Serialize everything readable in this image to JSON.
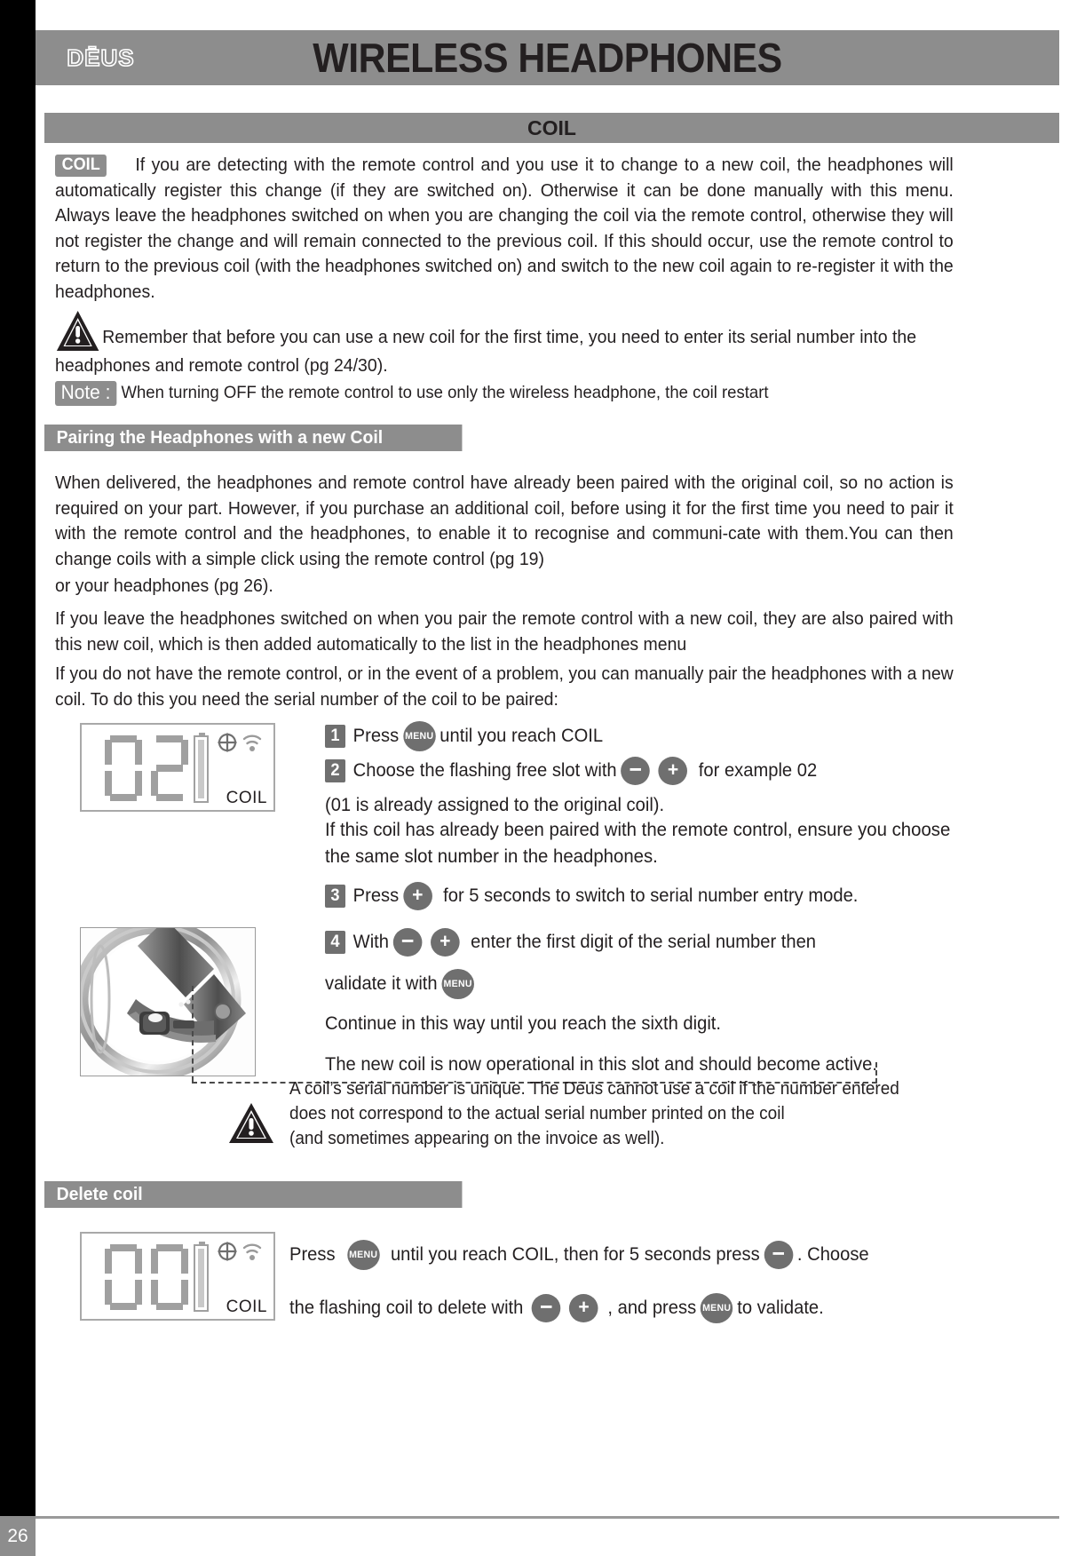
{
  "header": {
    "brand": "DĒUS",
    "title": "WIRELESS HEADPHONES",
    "section": "COIL"
  },
  "intro": {
    "chip": "COIL",
    "text": "If you are detecting with the remote control and you use it to change to a new coil, the headphones will automatically register this change (if they are switched on). Otherwise it can be done manually with this menu. Always leave the headphones switched on when you are changing the coil via the remote control, otherwise they will not register the change and will remain connected to the previous coil. If this should occur, use the remote control to return to the previous coil (with the headphones switched on) and switch to the new coil again to re-register it with the headphones."
  },
  "warning_1": {
    "icon": "warning-triangle-icon",
    "text": "Remember that before you can use a new coil for the first time, you need to enter its serial number into the headphones and remote control (pg 24/30)."
  },
  "note": {
    "label": "Note :",
    "text": "When turning OFF the remote control to use only the wireless headphone, the coil restart"
  },
  "pairing": {
    "heading": "Pairing the Headphones with a new Coil",
    "para_1": "When delivered, the headphones and remote control have already been paired with the original coil, so no action is required on your part. However, if you purchase an additional coil, before using it for the first time you need to pair it with the remote control and the headphones, to enable it to recognise and communi-cate with them.You can then change coils with a simple click using the remote control (pg 19)",
    "para_1b": "or your headphones (pg 26).",
    "para_2": "If you leave the headphones switched on when you pair the remote control with a new coil, they are also paired with this new coil, which is then added automatically to the list in the headphones menu",
    "para_3": "If you do not have the remote control, or in the event of a problem, you can manually pair the headphones with a new coil. To do this you need the serial number of the coil to be paired:"
  },
  "lcd_pair": {
    "digits": "02",
    "label": "COIL",
    "icons": [
      "battery-icon",
      "coil-icon",
      "wireless-icon"
    ]
  },
  "steps": [
    {
      "num": "1",
      "pre": "Press",
      "buttons": [
        "MENU"
      ],
      "post": "until you reach COIL"
    },
    {
      "num": "2",
      "pre": "Choose the flashing free slot with",
      "buttons": [
        "−",
        "+"
      ],
      "post": "for example 02"
    },
    {
      "num": "3",
      "pre": "Press",
      "buttons": [
        "+"
      ],
      "post": "for 5 seconds to switch to serial number entry mode."
    },
    {
      "num": "4",
      "pre": "With",
      "buttons": [
        "−",
        "+"
      ],
      "post": "enter  the first digit of the serial number then"
    }
  ],
  "step_extras": {
    "after_2": "(01 is already assigned to the original coil).",
    "note_slot": "If this coil has already been paired with the remote control, ensure you choose the same slot number in the headphones.",
    "validate_pre": "validate it with",
    "validate_button": "MENU",
    "continue": "Continue in this way until you reach the sixth digit.",
    "operational": "The new coil is now operational in this slot and should become active."
  },
  "warning_2": {
    "icon": "warning-triangle-icon",
    "line1": "A coil’s serial number is unique. The Dēus cannot use a coil if the number entered",
    "line2": "does not correspond to the actual serial number printed on the coil",
    "line3": "(and sometimes appearing on the invoice as well)."
  },
  "delete": {
    "heading": "Delete coil",
    "lcd": {
      "digits": "00",
      "label": "COIL"
    },
    "line1_a": "Press",
    "line1_btn1": "MENU",
    "line1_b": "until you reach COIL, then for 5 seconds press",
    "line1_btn2": "−",
    "line1_c": ". Choose",
    "line2_a": "the flashing coil to delete with",
    "line2_btn1": "−",
    "line2_btn2": "+",
    "line2_b": ", and press",
    "line2_btn3": "MENU",
    "line2_c": "to validate."
  },
  "footer": {
    "page_number": "26"
  },
  "colors": {
    "grey_band": "#8d8d8d",
    "dark_text": "#231f20",
    "button_grey": "#6f6f6f",
    "lcd_segment": "#a0a0a0"
  }
}
